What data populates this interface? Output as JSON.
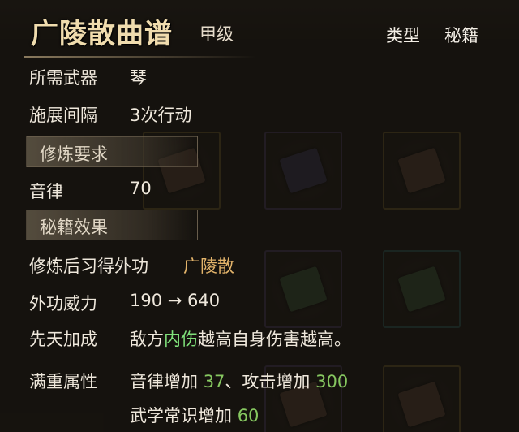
{
  "item": {
    "name": "广陵散曲谱",
    "grade": "甲级",
    "type_label": "类型",
    "type_value": "秘籍"
  },
  "stats": {
    "weapon_label": "所需武器",
    "weapon_value": "琴",
    "interval_label": "施展间隔",
    "interval_value": "3次行动"
  },
  "requirements": {
    "section_title": "修炼要求",
    "skill_label": "音律",
    "skill_value": "70"
  },
  "effects": {
    "section_title": "秘籍效果",
    "learn_label": "修炼后习得外功",
    "learn_value": "广陵散",
    "power_label": "外功威力",
    "power_value": "190 → 640",
    "innate_label": "先天加成",
    "innate_prefix": "敌方",
    "innate_highlight": "内伤",
    "innate_suffix": "越高自身伤害越高。",
    "full_label": "满重属性",
    "full_line1_a": "音律增加",
    "full_line1_a_num": "37",
    "full_line1_sep": "、攻击增加",
    "full_line1_b_num": "300",
    "full_line2_a": "武学常识增加",
    "full_line2_a_num": "60"
  },
  "colors": {
    "title": "#f0dcae",
    "highlight_gold": "#e2b36a",
    "highlight_green": "#7fe07a",
    "number_green": "#86c760"
  }
}
